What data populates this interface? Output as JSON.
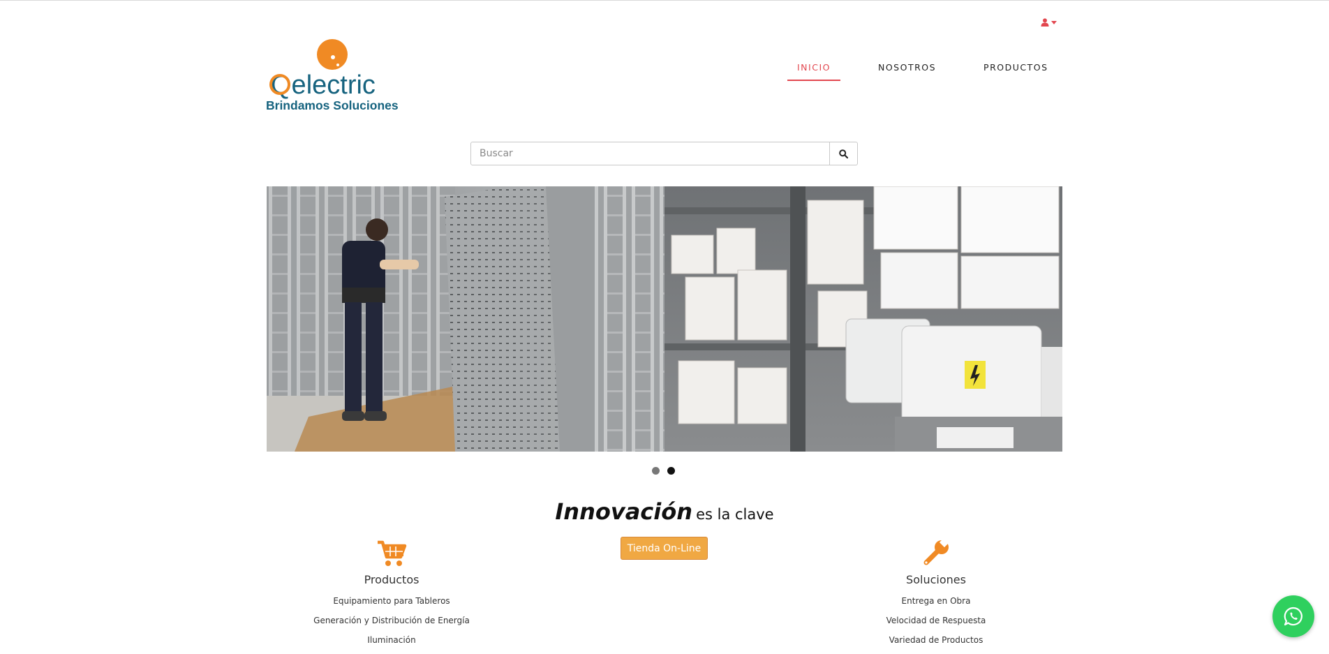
{
  "header": {
    "logo": {
      "brand": "Qelectric",
      "tagline": "Brindamos Soluciones"
    },
    "user_icon": "user-icon",
    "nav": [
      {
        "label": "INICIO",
        "active": true
      },
      {
        "label": "NOSOTROS",
        "active": false
      },
      {
        "label": "PRODUCTOS",
        "active": false
      }
    ]
  },
  "search": {
    "placeholder": "Buscar",
    "value": "",
    "icon": "search-icon"
  },
  "carousel": {
    "slide_count": 2,
    "active_slide": 2
  },
  "headline": {
    "emphasis": "Innovación",
    "rest": "es la clave"
  },
  "shop_button": {
    "label": "Tienda On-Line"
  },
  "columns": [
    {
      "icon": "shopping-cart-icon",
      "title": "Productos",
      "items": [
        "Equipamiento para Tableros",
        "Generación y Distribución de Energía",
        "Iluminación"
      ]
    },
    {
      "icon": "wrench-icon",
      "title": "Soluciones",
      "items": [
        "Entrega en Obra",
        "Velocidad de Respuesta",
        "Variedad de Productos"
      ]
    }
  ],
  "whatsapp": {
    "icon": "whatsapp-icon"
  },
  "colors": {
    "accent_red": "#e2474f",
    "orange": "#f08a24",
    "button_orange": "#f0a843",
    "brand_blue": "#16637f",
    "whatsapp_green": "#2fd05e"
  }
}
